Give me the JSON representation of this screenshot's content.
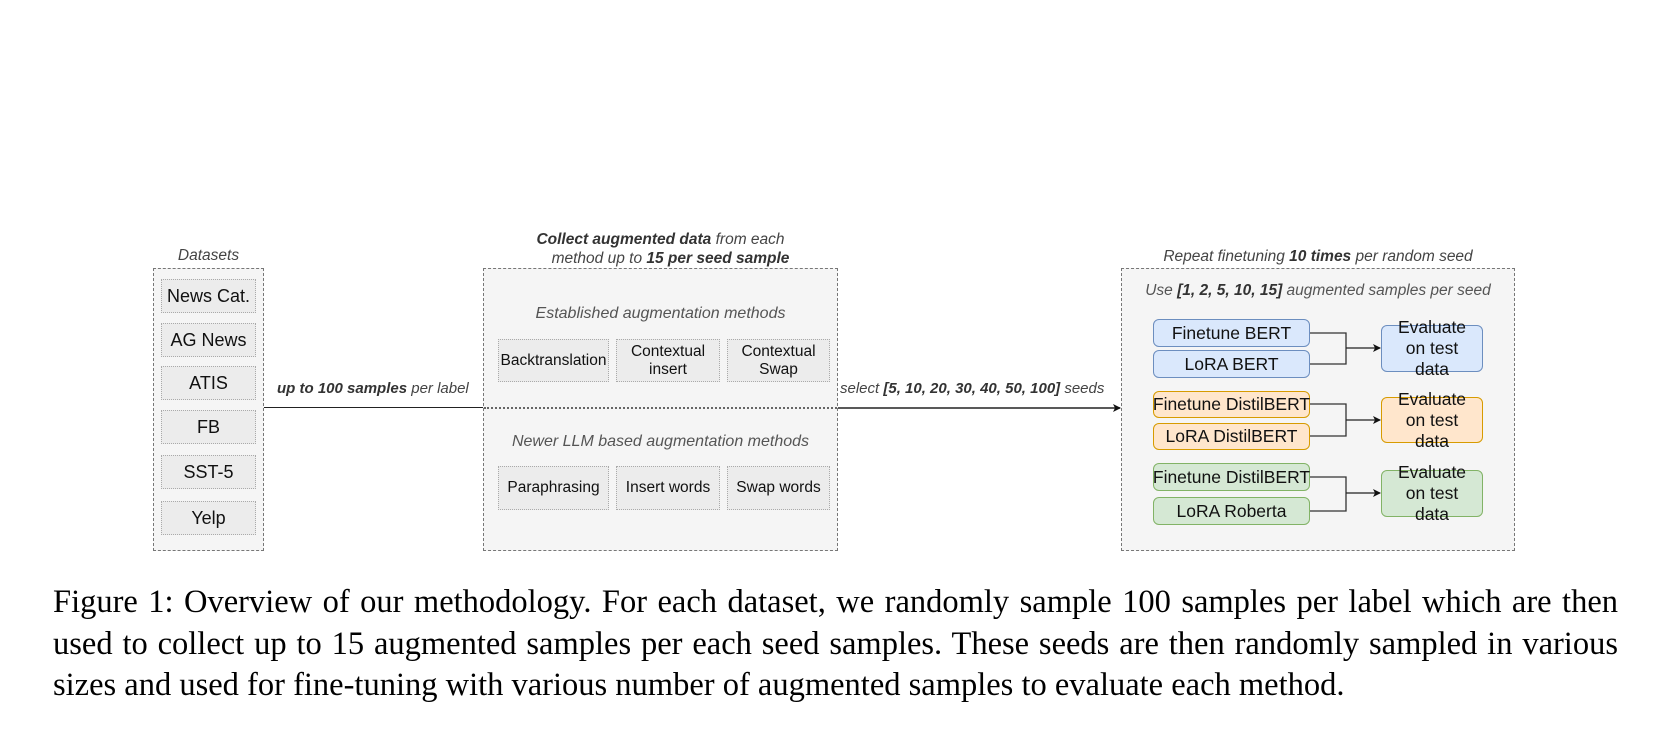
{
  "datasets": {
    "title": "Datasets",
    "items": [
      "News Cat.",
      "AG News",
      "ATIS",
      "FB",
      "SST-5",
      "Yelp"
    ]
  },
  "edge_datasets_to_augment": {
    "bold": "up to 100 samples",
    "rest": " per label"
  },
  "augmentation": {
    "title_line1_bold": "Collect augmented data",
    "title_line1_rest": " from each",
    "title_line2_pre": "method up to ",
    "title_line2_bold": "15 per seed sample",
    "established": {
      "label": "Established augmentation methods",
      "methods": [
        "Backtranslation",
        "Contextual insert",
        "Contextual Swap"
      ]
    },
    "llm": {
      "label": "Newer LLM based augmentation methods",
      "methods": [
        "Paraphrasing",
        "Insert words",
        "Swap words"
      ]
    }
  },
  "edge_augment_to_finetune": {
    "pre": "select ",
    "bold": "[5, 10, 20, 30, 40, 50, 100]",
    "rest": " seeds"
  },
  "finetuning": {
    "title_pre": "Repeat finetuning ",
    "title_bold": "10 times",
    "title_rest": " per random seed",
    "subtitle_pre": "Use ",
    "subtitle_bold": "[1, 2, 5, 10, 15]",
    "subtitle_rest": " augmented samples per  seed",
    "groups": [
      {
        "color": "blue",
        "models": [
          "Finetune BERT",
          "LoRA BERT"
        ],
        "evaluate": "Evaluate on test data"
      },
      {
        "color": "orange",
        "models": [
          "Finetune DistilBERT",
          "LoRA DistilBERT"
        ],
        "evaluate": "Evaluate on test data"
      },
      {
        "color": "green",
        "models": [
          "Finetune DistilBERT",
          "LoRA Roberta"
        ],
        "evaluate": "Evaluate on test data"
      }
    ]
  },
  "colors": {
    "blue_fill": "#dae8fc",
    "blue_border": "#6c8ebf",
    "orange_fill": "#ffe6cc",
    "orange_border": "#d79b00",
    "green_fill": "#d5e8d4",
    "green_border": "#82b366",
    "container_fill": "#f5f5f5"
  },
  "caption": "Figure 1: Overview of our methodology. For each dataset, we randomly sample 100 samples per label which are then used to collect up to 15 augmented samples per each seed samples. These seeds are then randomly sampled in various sizes and used for fine-tuning with various number of augmented samples to evaluate each method."
}
